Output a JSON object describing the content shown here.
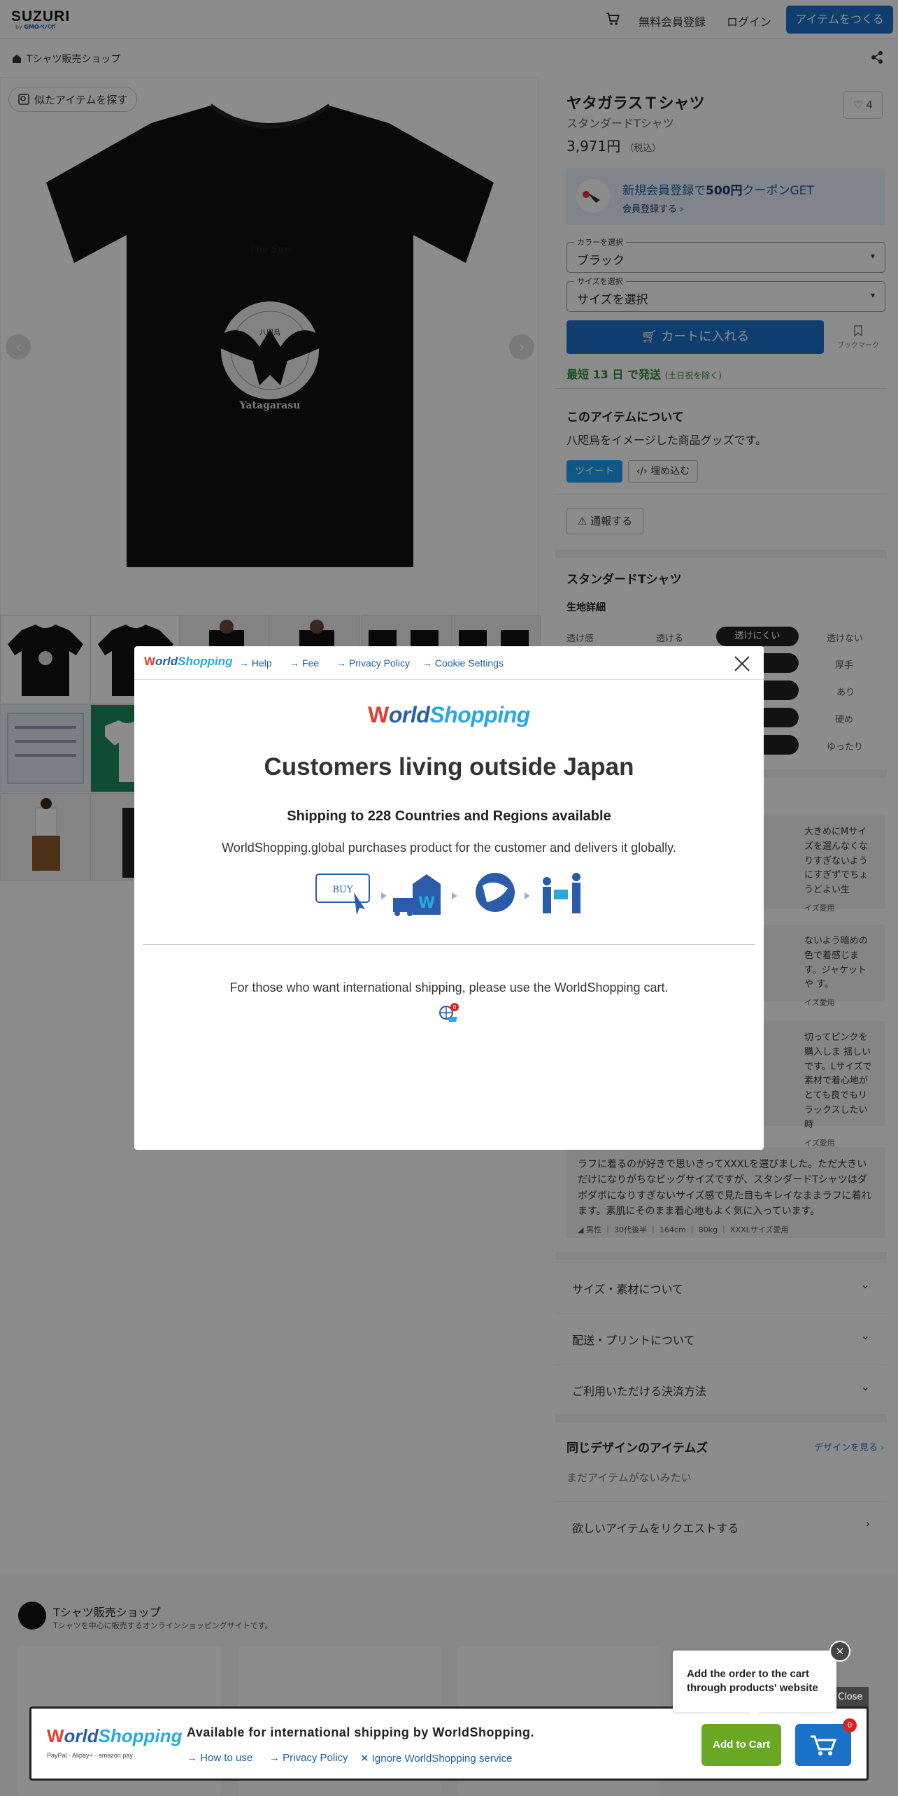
{
  "header": {
    "logo": "SUZURI",
    "logo_sub_prefix": "by",
    "logo_sub_brand": "GMOペパボ",
    "signup": "無料会員登録",
    "login": "ログイン",
    "create": "アイテムをつくる"
  },
  "breadcrumb": {
    "shop": "Tシャツ販売ショップ"
  },
  "gallery": {
    "similar": "似たアイテムを探す",
    "shirt_text_top": "The Sun",
    "shirt_text_bottom": "Yatagarasu",
    "shirt_seal": "八咫烏"
  },
  "product": {
    "title": "ヤタガラスＴシャツ",
    "subtitle": "スタンダードTシャツ",
    "price": "3,971円",
    "tax": "（税込）",
    "fav_count": "4",
    "coupon_prefix": "新規会員登録で",
    "coupon_bold": "500円",
    "coupon_suffix": "クーポンGET",
    "coupon_link": "会員登録する",
    "color_label": "カラーを選択",
    "color_value": "ブラック",
    "size_label": "サイズを選択",
    "size_value": "サイズを選択",
    "cart": "カートに入れる",
    "bookmark": "ブックマーク",
    "ship_main": "最短 13 日 で発送",
    "ship_note": "(土日祝を除く)",
    "about_title": "このアイテムについて",
    "about_text": "八咫烏をイメージした商品グッズです。",
    "tweet": "ツイート",
    "embed": "埋め込む",
    "report": "通報する"
  },
  "fabric": {
    "title": "スタンダードTシャツ",
    "subtitle": "生地詳細",
    "rows": [
      {
        "label": "透け感",
        "a": "透ける",
        "sel": "透けにくい",
        "b": "透けない"
      },
      {
        "label": "",
        "a": "",
        "sel": "",
        "b": "厚手"
      },
      {
        "label": "",
        "a": "",
        "sel": "",
        "b": "あり"
      },
      {
        "label": "",
        "a": "",
        "sel": "",
        "b": "硬め"
      },
      {
        "label": "",
        "a": "",
        "sel": "",
        "b": "ゆったり"
      }
    ]
  },
  "reviews": {
    "r1_text": "大きめにMサイズを選んなくなりすぎないようにすぎずでちょうどよい生",
    "r1_meta": "イズ愛用",
    "r2_text": "ないよう暗めの色で着感じます。ジャケットや す。",
    "r2_meta": "イズ愛用",
    "r3_text": "切ってピンクを購入しま 揺しいです。Lサイズで素材で着心地がとても良でもリラックスしたい時",
    "r3_meta": "イズ愛用",
    "r4_text": "ラフに着るのが好きで思いきってXXXLを選びました。ただ大きいだけになりがちなビッグサイズですが、スタンダードTシャツはダボダボになりすぎないサイズ感で見た目もキレイなままラフに着れます。素肌にそのまま着心地もよく気に入っています。",
    "r4_meta": "男性 ｜ 30代後半 ｜ 164cm ｜ 80kg ｜ XXXLサイズ愛用"
  },
  "accordion": {
    "size": "サイズ・素材について",
    "delivery": "配送・プリントについて",
    "payment": "ご利用いただける決済方法"
  },
  "same": {
    "title": "同じデザインのアイテムズ",
    "link": "デザインを見る",
    "empty": "まだアイテムがないみたい",
    "request": "欲しいアイテムをリクエストする"
  },
  "shop": {
    "name": "Tシャツ販売ショップ",
    "desc": "Tシャツを中心に販売するオンラインショッピングサイトです。"
  },
  "modal": {
    "logo_w": "W",
    "logo_orld": "orld",
    "logo_shopping": "Shopping",
    "help": "Help",
    "fee": "Fee",
    "privacy": "Privacy Policy",
    "cookie": "Cookie Settings",
    "heading": "Customers living outside Japan",
    "subheading": "Shipping to 228 Countries and Regions available",
    "desc": "WorldShopping.global purchases product for the customer and delivers it globally.",
    "buy": "BUY",
    "footer": "For those who want international shipping, please use the WorldShopping cart.",
    "cart_badge": "0"
  },
  "bottom_bar": {
    "title": "Available for international shipping by WorldShopping.",
    "how": "How to use",
    "privacy": "Privacy Policy",
    "ignore": "Ignore WorldShopping service",
    "pay": "PayPal  ·  Alipay+  ·  amazon pay",
    "add": "Add to Cart",
    "badge": "0",
    "close": "Close"
  },
  "tooltip": {
    "text": "Add the order to the cart through products' website"
  },
  "colors": {
    "accent": "#1a72c8",
    "ws_blue": "#2a5caa",
    "ws_red": "#e63c2f",
    "green": "#6aa823"
  }
}
